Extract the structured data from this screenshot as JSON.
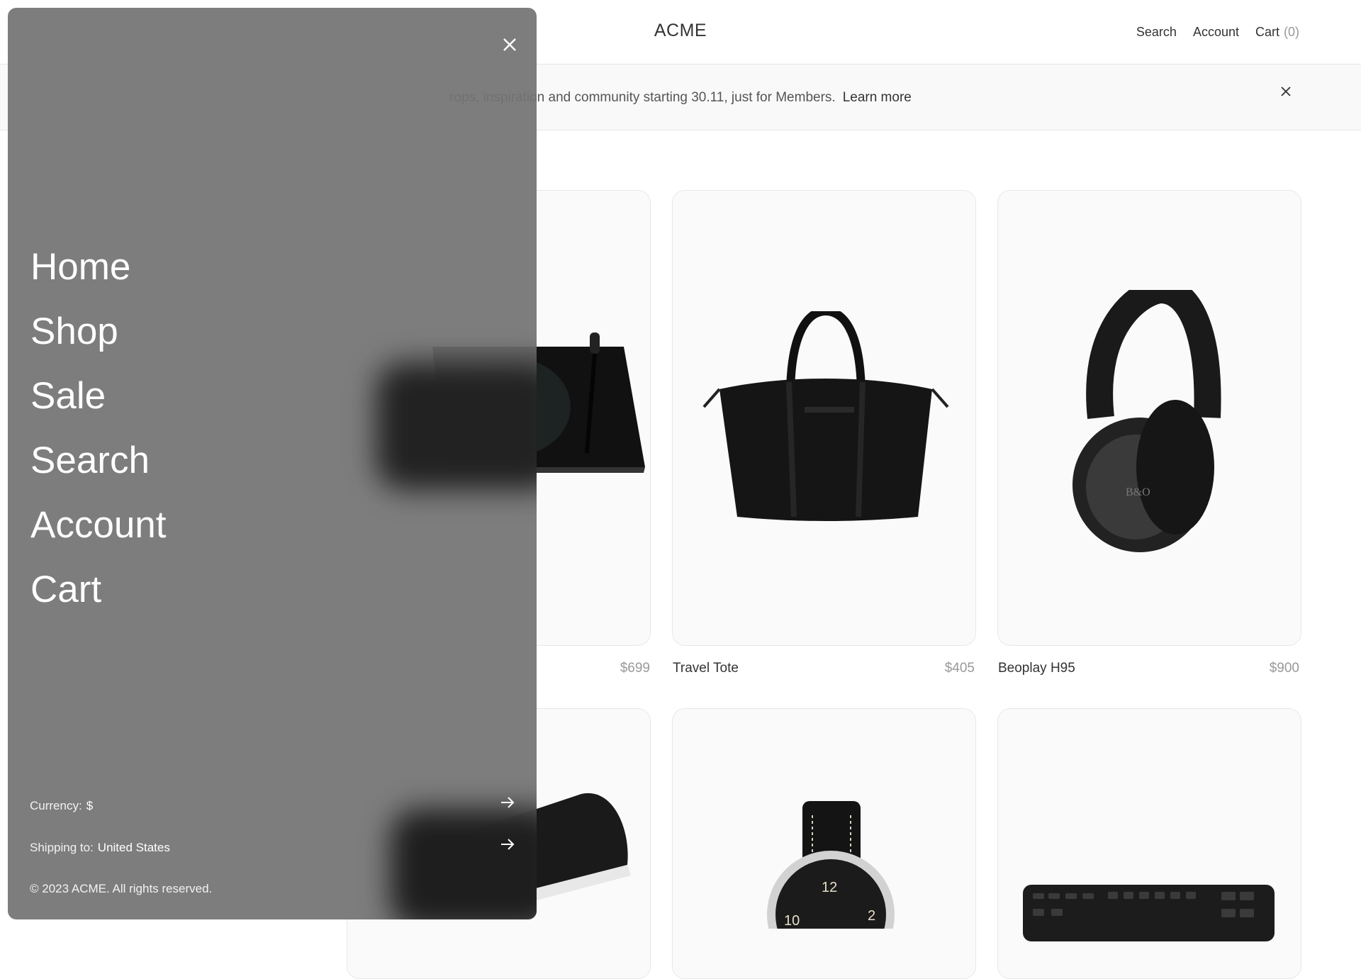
{
  "header": {
    "logo": "ACME",
    "nav": {
      "search": "Search",
      "account": "Account",
      "cart": "Cart",
      "cart_count": "(0)"
    }
  },
  "banner": {
    "text": "rops, inspiration and community starting 30.11, just for Members.",
    "link": "Learn more"
  },
  "products": [
    {
      "name": "",
      "price": "$699",
      "image": "turntable"
    },
    {
      "name": "Travel Tote",
      "price": "$405",
      "image": "tote-bag"
    },
    {
      "name": "Beoplay H95",
      "price": "$900",
      "image": "headphones"
    },
    {
      "name": "",
      "price": "",
      "image": "lamp"
    },
    {
      "name": "",
      "price": "",
      "image": "wristwatch"
    },
    {
      "name": "",
      "price": "",
      "image": "keyboard"
    }
  ],
  "drawer": {
    "menu": [
      "Home",
      "Shop",
      "Sale",
      "Search",
      "Account",
      "Cart"
    ],
    "currency_label": "Currency:",
    "currency_value": "$",
    "shipping_label": "Shipping to:",
    "shipping_value": "United States",
    "copyright": "© 2023 ACME. All rights reserved."
  },
  "colors": {
    "drawer_bg": "#737373",
    "card_bg": "#fafafa",
    "text": "#333333",
    "muted": "#999999"
  }
}
